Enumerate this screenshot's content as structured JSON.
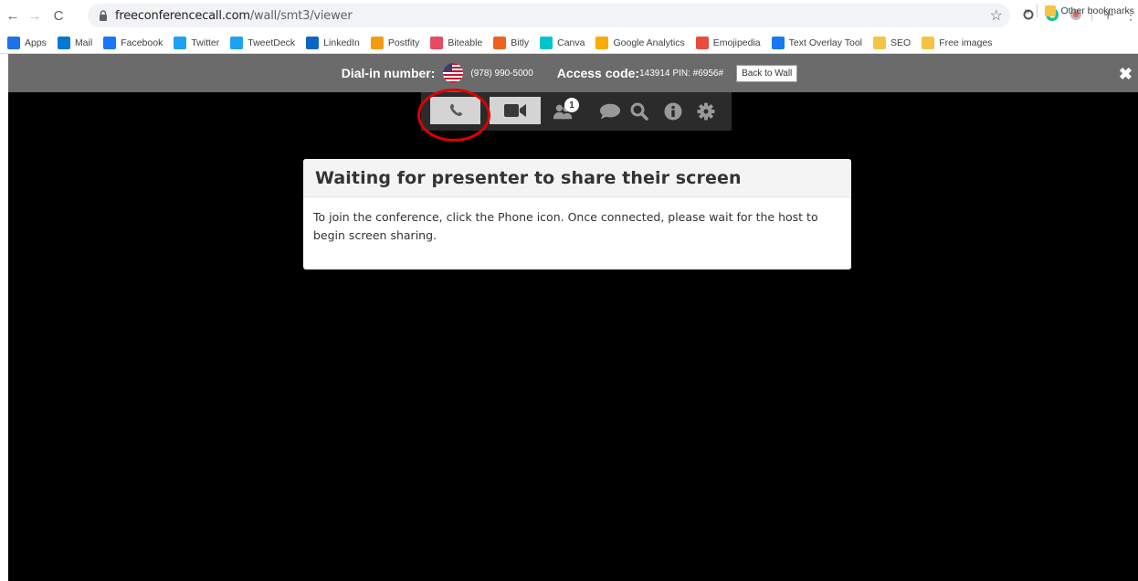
{
  "browser": {
    "url_host": "freeconferencecall.com",
    "url_path": "/wall/smt3/viewer",
    "bookmarks": [
      {
        "label": "Apps",
        "icon": "apps-grid-icon",
        "color": "#1a73e8"
      },
      {
        "label": "Mail",
        "icon": "outlook-icon",
        "color": "#0078d4"
      },
      {
        "label": "Facebook",
        "icon": "facebook-icon",
        "color": "#1877f2"
      },
      {
        "label": "Twitter",
        "icon": "twitter-icon",
        "color": "#1da1f2"
      },
      {
        "label": "TweetDeck",
        "icon": "tweetdeck-icon",
        "color": "#1da1f2"
      },
      {
        "label": "LinkedIn",
        "icon": "linkedin-icon",
        "color": "#0a66c2"
      },
      {
        "label": "Postfity",
        "icon": "postfity-icon",
        "color": "#f39c12"
      },
      {
        "label": "Biteable",
        "icon": "biteable-icon",
        "color": "#e84a5f"
      },
      {
        "label": "Bitly",
        "icon": "bitly-icon",
        "color": "#ee6123"
      },
      {
        "label": "Canva",
        "icon": "canva-icon",
        "color": "#00c4cc"
      },
      {
        "label": "Google Analytics",
        "icon": "analytics-icon",
        "color": "#f9ab00"
      },
      {
        "label": "Emojipedia",
        "icon": "emojipedia-icon",
        "color": "#e74c3c"
      },
      {
        "label": "Text Overlay Tool",
        "icon": "facebook-icon",
        "color": "#1877f2"
      },
      {
        "label": "SEO",
        "icon": "folder-icon",
        "color": "#f6c343"
      },
      {
        "label": "Free images",
        "icon": "folder-icon",
        "color": "#f6c343"
      }
    ],
    "overflow_label": "»",
    "other_bookmarks": "Other bookmarks"
  },
  "dialbar": {
    "dialin_label": "Dial-in number:",
    "dialin_number": "(978) 990-5000",
    "access_label": "Access code:",
    "access_code": "143914",
    "pin_text": "PIN: #6956#",
    "back_label": "Back to Wall"
  },
  "toolbar": {
    "participants_count": "1"
  },
  "dialog": {
    "title": "Waiting for presenter to share their screen",
    "body": "To join the conference, click the Phone icon. Once connected, please wait for the host to begin screen sharing."
  },
  "colors": {
    "dialbar_bg": "#6b6b6b",
    "toolbar_bg": "#2b2b2b",
    "highlight_circle": "#e00000"
  }
}
